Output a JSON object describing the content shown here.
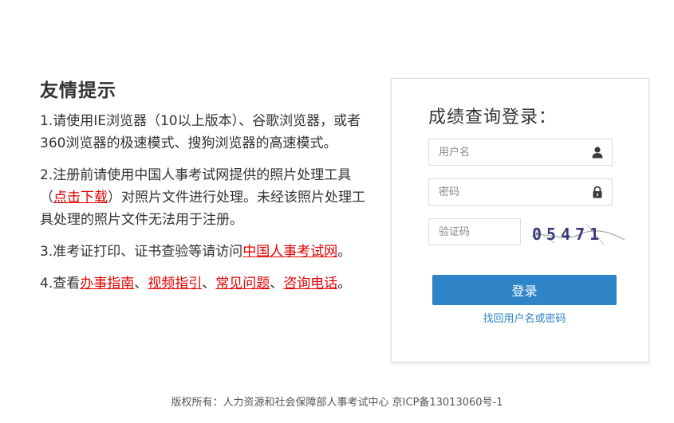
{
  "notice": {
    "title": "友情提示",
    "item1": "1.请使用IE浏览器（10以上版本）、谷歌浏览器，或者360浏览器的极速模式、搜狗浏览器的高速模式。",
    "item2_prefix": "2.注册前请使用中国人事考试网提供的照片处理工具（",
    "item2_link": "点击下载",
    "item2_suffix": "）对照片文件进行处理。未经该照片处理工具处理的照片文件无法用于注册。",
    "item3_prefix": "3.准考证打印、证书查验等请访问",
    "item3_link": "中国人事考试网",
    "item3_suffix": "。",
    "item4_prefix": "4.查看",
    "item4_link1": "办事指南",
    "sep1": "、",
    "item4_link2": "视频指引",
    "sep2": "、",
    "item4_link3": "常见问题",
    "sep3": "、",
    "item4_link4": "咨询电话",
    "item4_suffix": "。"
  },
  "login": {
    "title": "成绩查询登录：",
    "username_placeholder": "用户名",
    "password_placeholder": "密码",
    "captcha_placeholder": "验证码",
    "captcha_text": "05471",
    "submit_label": "登录",
    "forgot_label": "找回用户名或密码"
  },
  "footer": {
    "text": "版权所有：人力资源和社会保障部人事考试中心 京ICP备13013060号-1"
  },
  "colors": {
    "accent": "#2f84c7",
    "link_red": "#e10000"
  },
  "icons": {
    "user": "user-icon",
    "lock": "lock-icon"
  }
}
